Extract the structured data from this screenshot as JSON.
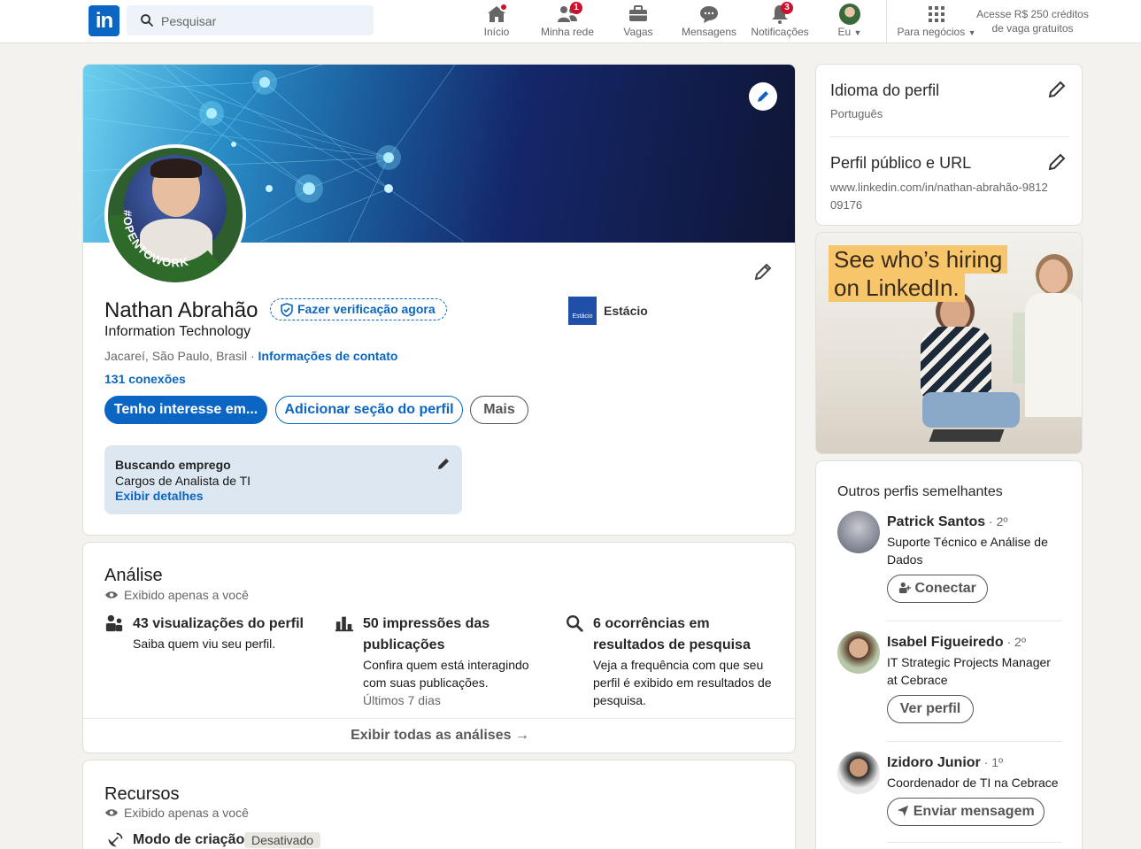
{
  "nav": {
    "logo": "in",
    "search_placeholder": "Pesquisar",
    "items": [
      {
        "label": "Início",
        "badge": ""
      },
      {
        "label": "Minha rede",
        "badge": "1"
      },
      {
        "label": "Vagas",
        "badge": ""
      },
      {
        "label": "Mensagens",
        "badge": ""
      },
      {
        "label": "Notificações",
        "badge": "3"
      },
      {
        "label": "Eu",
        "badge": ""
      },
      {
        "label": "Para negócios",
        "badge": ""
      }
    ],
    "promo": "Acesse R$ 250 créditos de vaga gratuitos"
  },
  "profile": {
    "opentowork": "#OPENTOWORK",
    "name": "Nathan Abrahão",
    "verify": "Fazer verificação agora",
    "headline": "Information Technology",
    "location": "Jacareí, São Paulo, Brasil",
    "location_sep": " · ",
    "contact": "Informações de contato",
    "connections": "131 conexões",
    "company": "Estácio",
    "company_logo_text": "Estácio",
    "btn_interest": "Tenho interesse em...",
    "btn_add_section": "Adicionar seção do perfil",
    "btn_more": "Mais",
    "job_title": "Buscando emprego",
    "job_desc": "Cargos de Analista de TI",
    "job_details": "Exibir detalhes"
  },
  "analytics": {
    "title": "Análise",
    "private": "Exibido apenas a você",
    "items": [
      {
        "title": "43 visualizações do perfil",
        "desc": "Saiba quem viu seu perfil.",
        "extra": ""
      },
      {
        "title": "50 impressões das publicações",
        "desc": "Confira quem está interagindo com suas publicações.",
        "extra": "Últimos 7 dias"
      },
      {
        "title": "6 ocorrências em resultados de pesquisa",
        "desc": "Veja a frequência com que seu perfil é exibido em resultados de pesquisa.",
        "extra": ""
      }
    ],
    "show_all": "Exibir todas as análises →"
  },
  "resources": {
    "title": "Recursos",
    "private": "Exibido apenas a você",
    "creator_mode": "Modo de criação",
    "creator_status": "Desativado"
  },
  "sidebar": {
    "lang_title": "Idioma do perfil",
    "lang_value": "Português",
    "url_title": "Perfil público e URL",
    "url_value": "www.linkedin.com/in/nathan-abrahão-981209176",
    "ad_line1": "See who’s hiring",
    "ad_line2": "on LinkedIn.",
    "similar_title": "Outros perfis semelhantes",
    "people": [
      {
        "name": "Patrick Santos",
        "degree": " · 2º",
        "desc": "Suporte Técnico e Análise de Dados",
        "action": "Conectar"
      },
      {
        "name": "Isabel Figueiredo",
        "degree": " · 2º",
        "desc": "IT Strategic Projects Manager at Cebrace",
        "action": "Ver perfil"
      },
      {
        "name": "Izidoro Junior",
        "degree": " · 1º",
        "desc": "Coordenador de TI na Cebrace",
        "action": "Enviar mensagem"
      }
    ]
  },
  "colors": {
    "brand": "#0a66c2",
    "badge": "#cb112d",
    "otw_green": "#2e6b2a",
    "ad_yellow": "#f7c66b"
  }
}
